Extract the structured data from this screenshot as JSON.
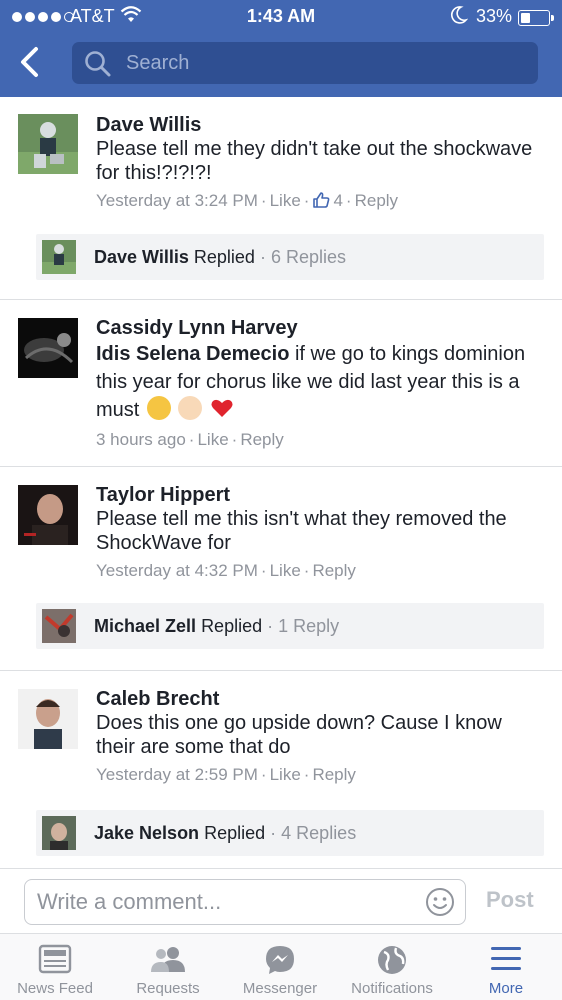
{
  "status_bar": {
    "carrier": "AT&T",
    "time": "1:43 AM",
    "battery": "33%"
  },
  "search": {
    "placeholder": "Search"
  },
  "comments": [
    {
      "author": "Dave Willis",
      "text": "Please tell me they didn't take out the shockwave for this!?!?!?!",
      "time": "Yesterday at 3:24 PM",
      "like": "Like",
      "like_count": "4",
      "reply": "Reply",
      "reply_summary": {
        "name": "Dave Willis",
        "replied": "Replied",
        "count": "6 Replies"
      }
    },
    {
      "author": "Cassidy Lynn Harvey",
      "tag": "Idis Selena Demecio",
      "text": " if we go to kings dominion this year for chorus like we did last year this is a must",
      "time": "3 hours ago",
      "like": "Like",
      "reply": "Reply"
    },
    {
      "author": "Taylor Hippert",
      "text": "Please tell me this isn't what they removed the ShockWave for",
      "time": "Yesterday at 4:32 PM",
      "like": "Like",
      "reply": "Reply",
      "reply_summary": {
        "name": "Michael Zell",
        "replied": "Replied",
        "count": "1 Reply"
      }
    },
    {
      "author": "Caleb Brecht",
      "text": "Does this one go upside down? Cause I know their are some that do",
      "time": "Yesterday at 2:59 PM",
      "like": "Like",
      "reply": "Reply",
      "reply_summary": {
        "name": "Jake Nelson",
        "replied": "Replied",
        "count": "4 Replies"
      }
    }
  ],
  "composer": {
    "placeholder": "Write a comment...",
    "post": "Post"
  },
  "tabs": [
    {
      "label": "News Feed",
      "icon": "news-feed-icon"
    },
    {
      "label": "Requests",
      "icon": "friend-requests-icon"
    },
    {
      "label": "Messenger",
      "icon": "messenger-icon"
    },
    {
      "label": "Notifications",
      "icon": "globe-icon"
    },
    {
      "label": "More",
      "icon": "menu-icon",
      "active": true
    }
  ],
  "colors": {
    "brand_blue": "#4267b2",
    "search_bg": "#2f4f92",
    "muted_text": "#90949c",
    "reply_bar_bg": "#f2f3f5"
  }
}
